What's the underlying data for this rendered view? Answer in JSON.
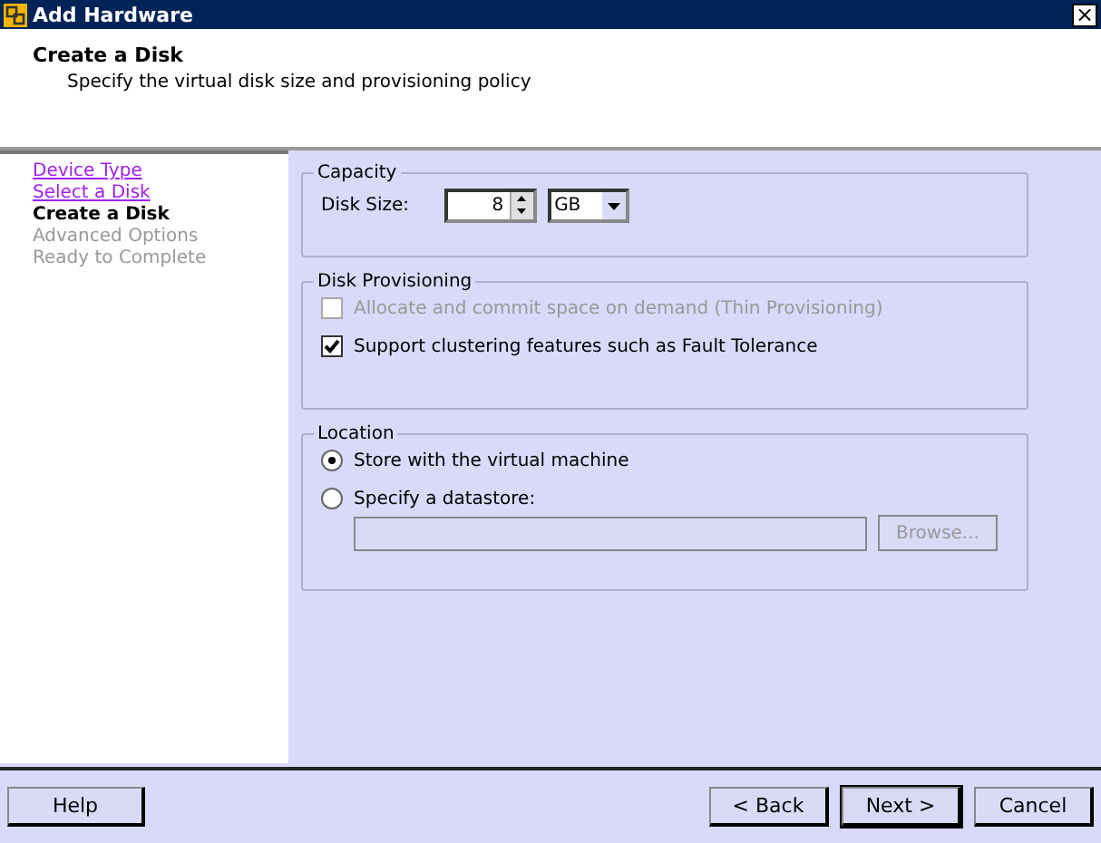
{
  "window": {
    "title": "Add Hardware",
    "close": "×"
  },
  "header": {
    "title": "Create a Disk",
    "subtitle": "Specify the virtual disk size and provisioning policy"
  },
  "steps": [
    {
      "label": "Device Type",
      "selected": false,
      "disabled": false
    },
    {
      "label": "Select a Disk",
      "selected": false,
      "disabled": false
    },
    {
      "label": "Create a Disk",
      "selected": true,
      "disabled": false
    },
    {
      "label": "Advanced Options",
      "selected": false,
      "disabled": true
    },
    {
      "label": "Ready to Complete",
      "selected": false,
      "disabled": true
    }
  ],
  "capacity": {
    "legend": "Capacity",
    "label": "Disk Size:",
    "value": "8",
    "unit": "GB"
  },
  "provisioning": {
    "legend": "Disk Provisioning",
    "options": [
      {
        "label": "Allocate and commit space on demand (Thin Provisioning)",
        "checked": false,
        "disabled": true
      },
      {
        "label": "Support clustering features such as Fault Tolerance",
        "checked": true,
        "disabled": false
      }
    ]
  },
  "location": {
    "legend": "Location",
    "options": [
      {
        "label": "Store with the virtual machine",
        "selected": true
      },
      {
        "label": "Specify a datastore:",
        "selected": false
      }
    ],
    "browse": {
      "label": "Browse...",
      "disabled": true
    }
  },
  "buttons": {
    "help": "Help",
    "back": "< Back",
    "next": "Next >",
    "cancel": "Cancel"
  }
}
